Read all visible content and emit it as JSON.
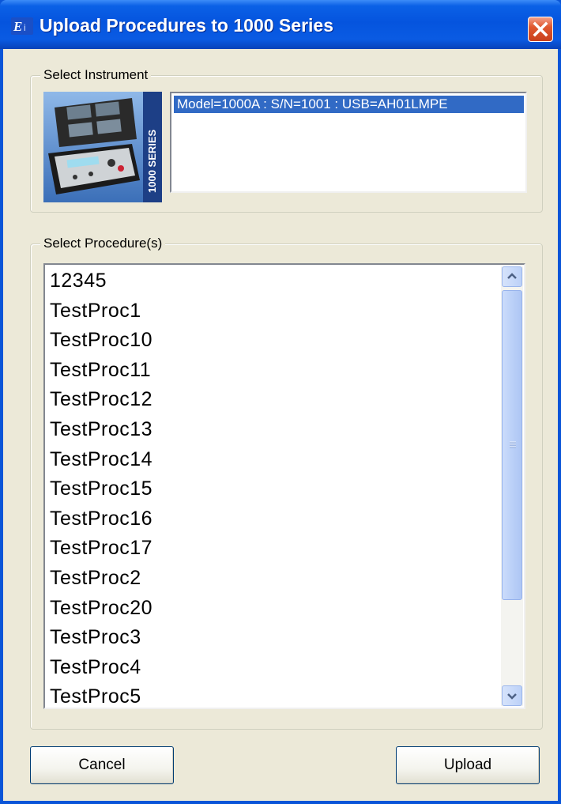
{
  "window": {
    "title": "Upload Procedures to 1000 Series",
    "app_icon": "ei-app-icon",
    "close_icon": "close-icon"
  },
  "instrument_group": {
    "label": "Select Instrument",
    "device_image": "1000-series-instrument-image",
    "image_caption": "1000 SERIES",
    "items": [
      {
        "label": "Model=1000A : S/N=1001 : USB=AH01LMPE",
        "selected": true
      }
    ]
  },
  "procedure_group": {
    "label": "Select Procedure(s)",
    "items": [
      "12345",
      "TestProc1",
      "TestProc10",
      "TestProc11",
      "TestProc12",
      "TestProc13",
      "TestProc14",
      "TestProc15",
      "TestProc16",
      "TestProc17",
      "TestProc2",
      "TestProc20",
      "TestProc3",
      "TestProc4",
      "TestProc5"
    ]
  },
  "buttons": {
    "cancel": "Cancel",
    "upload": "Upload"
  },
  "colors": {
    "titlebar": "#0554de",
    "dialog_bg": "#ece9d8",
    "selection": "#316ac5",
    "close_button": "#e0582f"
  }
}
